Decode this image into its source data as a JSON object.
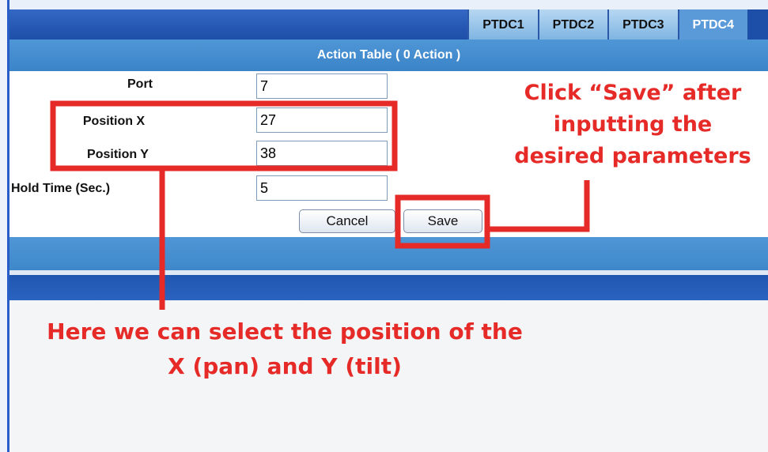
{
  "tabs": [
    {
      "label": "PTDC1",
      "active": false
    },
    {
      "label": "PTDC2",
      "active": false
    },
    {
      "label": "PTDC3",
      "active": false
    },
    {
      "label": "PTDC4",
      "active": true
    }
  ],
  "header": {
    "title": "Action Table  ( 0 Action )"
  },
  "form": {
    "port": {
      "label": "Port",
      "value": "7"
    },
    "position_x": {
      "label": "Position X",
      "value": "27"
    },
    "position_y": {
      "label": "Position Y",
      "value": "38"
    },
    "hold_time": {
      "label": "Hold Time (Sec.)",
      "value": "5"
    }
  },
  "buttons": {
    "cancel_label": "Cancel",
    "save_label": "Save"
  },
  "annotations": {
    "save_line1": "Click “Save” after",
    "save_line2": "inputting the",
    "save_line3": "desired parameters",
    "position_line1": "Here we can select the position of the",
    "position_line2": "X (pan) and Y (tilt)"
  },
  "colors": {
    "annotation_red": "#e52a27",
    "tabbar_blue": "#1d4ea8",
    "titlebar_blue": "#4a92d4"
  }
}
